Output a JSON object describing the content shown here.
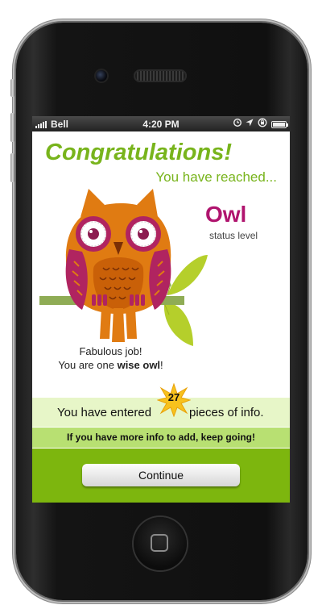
{
  "status_bar": {
    "carrier": "Bell",
    "time": "4:20 PM"
  },
  "screen": {
    "title": "Congratulations!",
    "reached_text": "You have reached...",
    "level_name": "Owl",
    "level_subtitle": "status level",
    "praise_line1": "Fabulous job!",
    "praise_line2_prefix": "You are one ",
    "praise_line2_bold": "wise owl",
    "praise_line2_suffix": "!",
    "info_prefix": "You have entered",
    "info_count": "27",
    "info_suffix": "pieces of info.",
    "keep_going": "If you have more info to add, keep going!",
    "continue_label": "Continue"
  },
  "colors": {
    "accent_green": "#78b41c",
    "level_magenta": "#b0146e",
    "band_light": "#e7f6c8",
    "band_mid": "#b8e072",
    "band_dark": "#7db60e",
    "star_yellow": "#f7c21d"
  },
  "icons": [
    "signal-bars-icon",
    "clock-icon",
    "location-arrow-icon",
    "rotation-lock-icon",
    "battery-icon",
    "starburst-icon",
    "owl-illustration",
    "home-button-icon"
  ]
}
